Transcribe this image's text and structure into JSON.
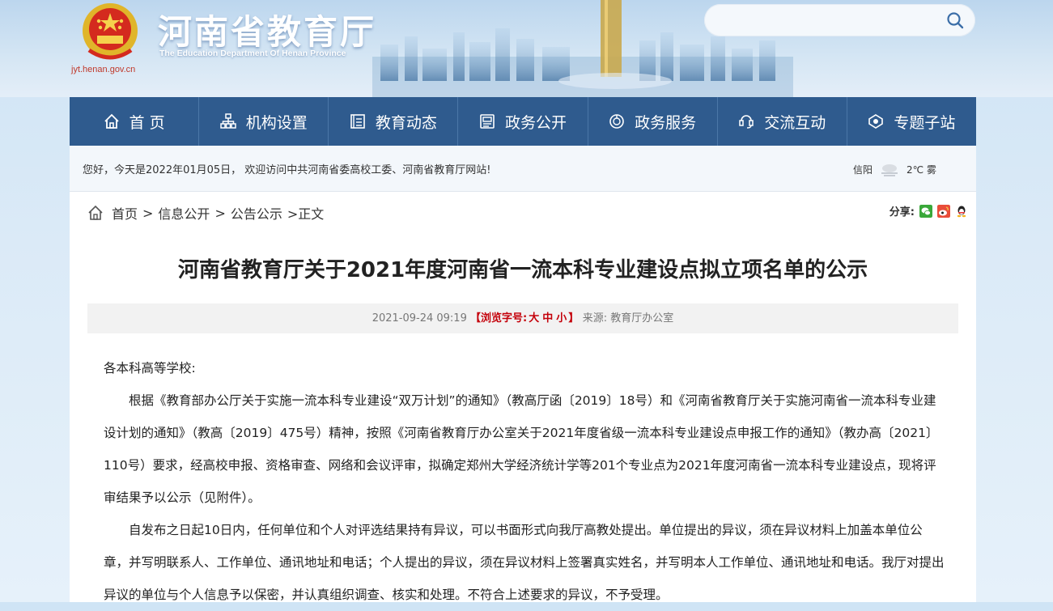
{
  "header": {
    "logo_cn": "河南省教育厅",
    "logo_en": "The Education Department Of Henan Province",
    "site_url": "jyt.henan.gov.cn",
    "search_placeholder": ""
  },
  "nav": [
    {
      "label": "首 页",
      "icon": "home-icon"
    },
    {
      "label": "机构设置",
      "icon": "org-icon"
    },
    {
      "label": "教育动态",
      "icon": "news-icon"
    },
    {
      "label": "政务公开",
      "icon": "public-icon"
    },
    {
      "label": "政务服务",
      "icon": "service-icon"
    },
    {
      "label": "交流互动",
      "icon": "interact-icon"
    },
    {
      "label": "专题子站",
      "icon": "subsite-icon"
    }
  ],
  "welcome": {
    "text": "您好，今天是2022年01月05日， 欢迎访问中共河南省委高校工委、河南省教育厅网站!",
    "city": "信阳",
    "weather": "2℃ 雾"
  },
  "breadcrumb": {
    "home": "首页",
    "level1": "信息公开",
    "level2": "公告公示",
    "current": ">正文",
    "sep": ">"
  },
  "share": {
    "label": "分享:"
  },
  "article": {
    "title": "河南省教育厅关于2021年度河南省一流本科专业建设点拟立项名单的公示",
    "date": "2021-09-24 09:19",
    "font_label_open": "【浏览字号:",
    "font_large": "大",
    "font_medium": "中",
    "font_small": "小",
    "font_label_close": "】",
    "source": "来源: 教育厅办公室",
    "salutation": "各本科高等学校:",
    "para1": "根据《教育部办公厅关于实施一流本科专业建设“双万计划”的通知》（教高厅函〔2019〕18号）和《河南省教育厅关于实施河南省一流本科专业建设计划的通知》（教高〔2019〕475号）精神，按照《河南省教育厅办公室关于2021年度省级一流本科专业建设点申报工作的通知》（教办高〔2021〕110号）要求，经高校申报、资格审查、网络和会议评审，拟确定郑州大学经济统计学等201个专业点为2021年度河南省一流本科专业建设点，现将评审结果予以公示（见附件）。",
    "para2": "自发布之日起10日内，任何单位和个人对评选结果持有异议，可以书面形式向我厅高教处提出。单位提出的异议，须在异议材料上加盖本单位公章，并写明联系人、工作单位、通讯地址和电话；个人提出的异议，须在异议材料上签署真实姓名，并写明本人工作单位、通讯地址和电话。我厅对提出异议的单位与个人信息予以保密，并认真组织调查、核实和处理。不符合上述要求的异议，不予受理。"
  }
}
